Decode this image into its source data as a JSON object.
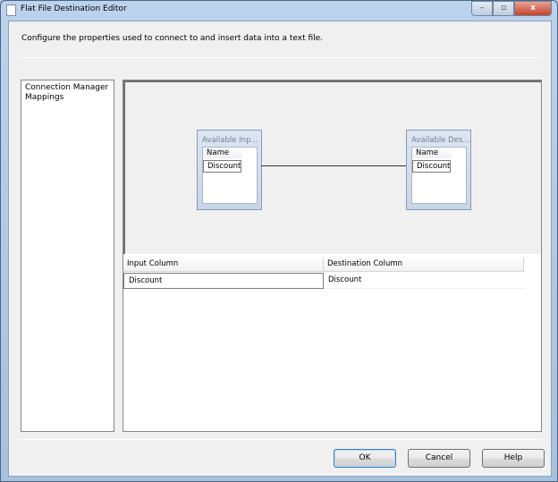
{
  "window": {
    "title": "Flat File Destination Editor",
    "minimize": "–",
    "maximize": "▫",
    "close": "x"
  },
  "description": "Configure the properties used to connect to and insert data into a text file.",
  "nav": {
    "items": [
      "Connection Manager",
      "Mappings"
    ]
  },
  "diagram": {
    "input_box": {
      "title": "Available Inp...",
      "header": "Name",
      "columns": [
        "Discount"
      ]
    },
    "dest_box": {
      "title": "Available Des...",
      "header": "Name",
      "columns": [
        "Discount"
      ]
    }
  },
  "grid": {
    "headers": [
      "Input Column",
      "Destination Column"
    ],
    "rows": [
      [
        "Discount",
        "Discount"
      ]
    ]
  },
  "buttons": {
    "ok": "OK",
    "cancel": "Cancel",
    "help": "Help"
  }
}
